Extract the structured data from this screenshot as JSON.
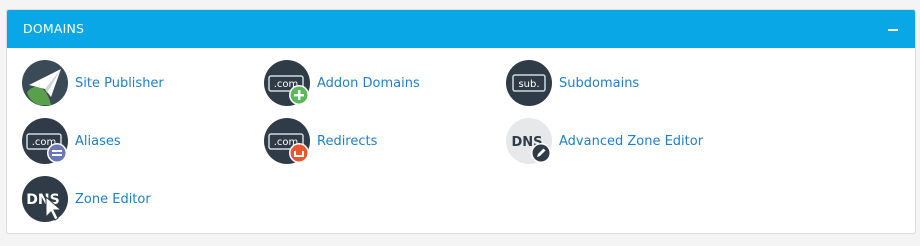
{
  "panel": {
    "title": "DOMAINS",
    "collapse_icon": "minus-icon",
    "accent_color": "#0aa7e6",
    "link_color": "#1f7fc7"
  },
  "items": [
    {
      "label": "Site Publisher",
      "icon": "paper-plane-icon"
    },
    {
      "label": "Addon Domains",
      "icon": "com-plus-icon",
      "icon_text": ".com"
    },
    {
      "label": "Subdomains",
      "icon": "sub-icon",
      "icon_text": "sub."
    },
    {
      "label": "Aliases",
      "icon": "com-equals-icon",
      "icon_text": ".com"
    },
    {
      "label": "Redirects",
      "icon": "com-redirect-icon",
      "icon_text": ".com"
    },
    {
      "label": "Advanced Zone Editor",
      "icon": "dns-edit-icon",
      "icon_text": "DNS"
    },
    {
      "label": "Zone Editor",
      "icon": "dns-cursor-icon",
      "icon_text": "DNS"
    }
  ]
}
